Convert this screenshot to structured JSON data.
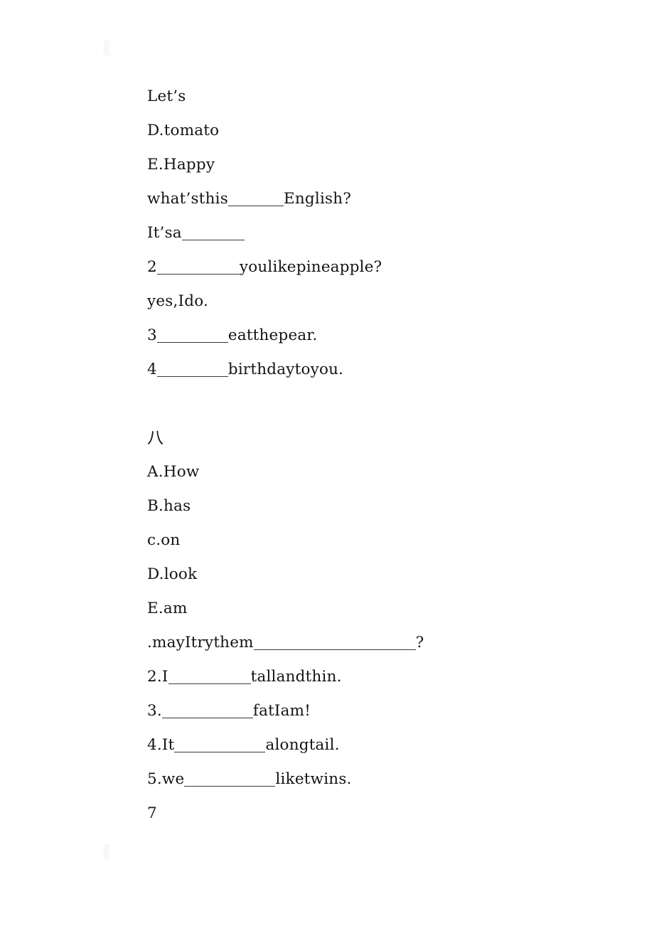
{
  "document": {
    "page_number": "7",
    "artifacts": {
      "top_mark": "░",
      "bottom_mark": "░"
    },
    "blocks": [
      {
        "name": "exercise-block-seven",
        "lines": [
          {
            "name": "line-lets",
            "before": "Let’s",
            "blank": "",
            "after": ""
          },
          {
            "name": "line-option-d-tomato",
            "before": "D.tomato",
            "blank": "",
            "after": ""
          },
          {
            "name": "line-option-e-happy",
            "before": "E.Happy",
            "blank": "",
            "after": ""
          },
          {
            "name": "line-what-is-this",
            "before": "what’sthis",
            "blank": "b-sm",
            "after": "English?"
          },
          {
            "name": "line-its-a",
            "before": "It’sa",
            "blank": "b-md",
            "after": ""
          },
          {
            "name": "line-q2-pineapple",
            "before": "2",
            "blank": "b-xl",
            "after": "youlikepineapple?"
          },
          {
            "name": "line-answer-yes-i-do",
            "before": "yes,Ido.",
            "blank": "",
            "after": ""
          },
          {
            "name": "line-q3-eat-pear",
            "before": "3",
            "blank": "b-lg",
            "after": "eatthepear."
          },
          {
            "name": "line-q4-birthday",
            "before": "4",
            "blank": "b-lg",
            "after": "birthdaytoyou."
          }
        ]
      },
      {
        "name": "exercise-block-eight",
        "heading": "八",
        "lines": [
          {
            "name": "line-option-a-how",
            "before": "A.How",
            "blank": "",
            "after": ""
          },
          {
            "name": "line-option-b-has",
            "before": "B.has",
            "blank": "",
            "after": ""
          },
          {
            "name": "line-option-c-on",
            "before": "c.on",
            "blank": "",
            "after": ""
          },
          {
            "name": "line-option-d-look",
            "before": "D.look",
            "blank": "",
            "after": ""
          },
          {
            "name": "line-option-e-am",
            "before": "E.am",
            "blank": "",
            "after": ""
          },
          {
            "name": "line-q1-may-i-try",
            "before": ".mayItrythem",
            "blank": "b-wide",
            "after": "?"
          },
          {
            "name": "line-q2-tall-and-thin",
            "before": "2.I",
            "blank": "b-xl",
            "after": "tallandthin."
          },
          {
            "name": "line-q3-fat-i-am",
            "before": "3.",
            "blank": "b-xxl",
            "after": "fatIam!"
          },
          {
            "name": "line-q4-long-tail",
            "before": "4.It",
            "blank": "b-xxl",
            "after": "alongtail."
          },
          {
            "name": "line-q5-like-twins",
            "before": "5.we",
            "blank": "b-xxl",
            "after": "liketwins."
          }
        ]
      }
    ]
  }
}
